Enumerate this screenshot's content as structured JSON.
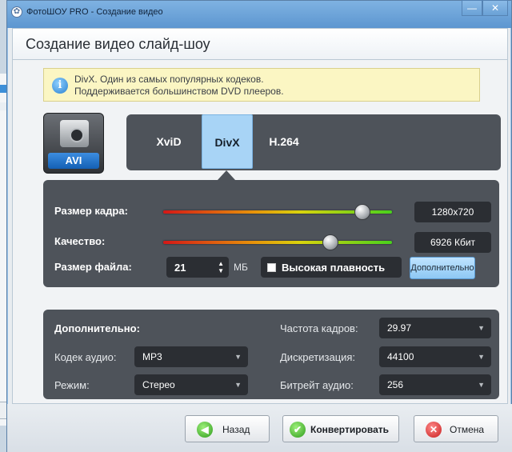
{
  "window": {
    "title": "ФотоШОУ PRO - Создание видео",
    "minimize_glyph": "—",
    "close_glyph": "✕"
  },
  "header": {
    "title": "Создание видео слайд-шоу"
  },
  "info": {
    "line1": "DivX. Один из самых популярных кодеков.",
    "line2": "Поддерживается большинством DVD плееров.",
    "icon_glyph": "i"
  },
  "format": {
    "label": "AVI",
    "icon": "video-camera-icon"
  },
  "codecs": [
    {
      "label": "XviD",
      "selected": false
    },
    {
      "label": "DivX",
      "selected": true
    },
    {
      "label": "H.264",
      "selected": false
    }
  ],
  "params": {
    "frame_size": {
      "label": "Размер кадра:",
      "value": "1280x720",
      "level": 0.87
    },
    "quality": {
      "label": "Качество:",
      "value": "6926 Кбит",
      "level": 0.73
    },
    "file_size": {
      "label": "Размер файла:",
      "value": "21",
      "unit": "МБ"
    },
    "smoothness_label": "Высокая плавность",
    "advanced_button": "Дополнительно"
  },
  "extra": {
    "title": "Дополнительно:",
    "audio_codec": {
      "label": "Кодек аудио:",
      "value": "MP3"
    },
    "mode": {
      "label": "Режим:",
      "value": "Стерео"
    },
    "frame_rate": {
      "label": "Частота кадров:",
      "value": "29.97"
    },
    "sampling": {
      "label": "Дискретизация:",
      "value": "44100"
    },
    "audio_bitrate": {
      "label": "Битрейт аудио:",
      "value": "256"
    }
  },
  "footer": {
    "back": "Назад",
    "convert": "Конвертировать",
    "cancel": "Отмена"
  },
  "colors": {
    "accent": "#a8d4f6",
    "panel": "#4e535a",
    "title_bar": "#6aa1d6"
  }
}
